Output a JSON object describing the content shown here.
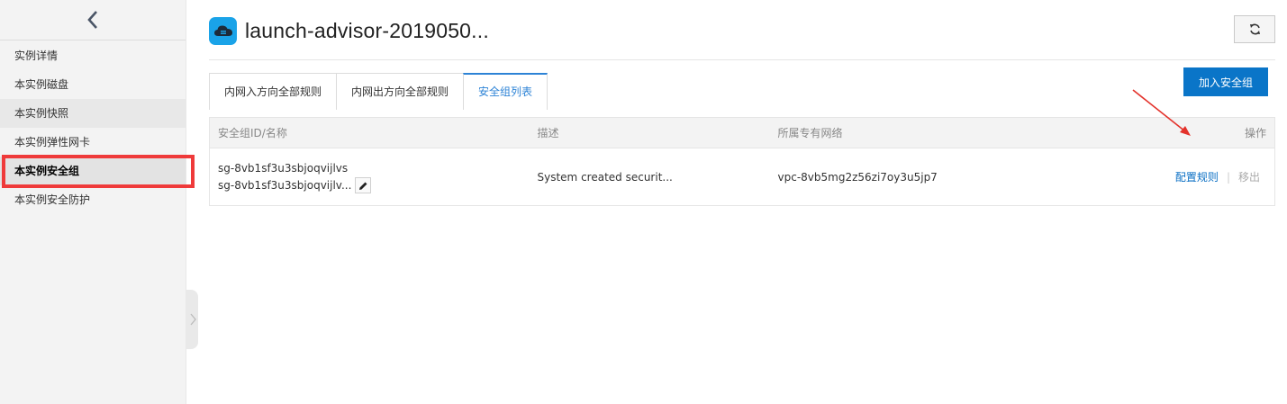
{
  "sidebar": {
    "back_icon": "chevron-left-icon",
    "items": [
      {
        "label": "实例详情"
      },
      {
        "label": "本实例磁盘"
      },
      {
        "label": "本实例快照"
      },
      {
        "label": "本实例弹性网卡"
      },
      {
        "label": "本实例安全组"
      },
      {
        "label": "本实例安全防护"
      }
    ],
    "active_index": 4
  },
  "header": {
    "icon": "cloud-icon",
    "title": "launch-advisor-2019050...",
    "refresh_icon": "refresh-icon"
  },
  "tabs": [
    {
      "label": "内网入方向全部规则"
    },
    {
      "label": "内网出方向全部规则"
    },
    {
      "label": "安全组列表"
    }
  ],
  "active_tab": 2,
  "toolbar": {
    "add_label": "加入安全组"
  },
  "table": {
    "columns": {
      "id_name": "安全组ID/名称",
      "desc": "描述",
      "vpc": "所属专有网络",
      "ops": "操作"
    },
    "rows": [
      {
        "id": "sg-8vb1sf3u3sbjoqvijlvs",
        "name": "sg-8vb1sf3u3sbjoqvijlv...",
        "desc": "System created securit...",
        "vpc": "vpc-8vb5mg2z56zi7oy3u5jp7",
        "action_config": "配置规则",
        "action_remove": "移出"
      }
    ]
  },
  "colors": {
    "accent": "#0a75c8",
    "highlight": "#ef3a3a",
    "icon_blue": "#1aa3e8"
  }
}
